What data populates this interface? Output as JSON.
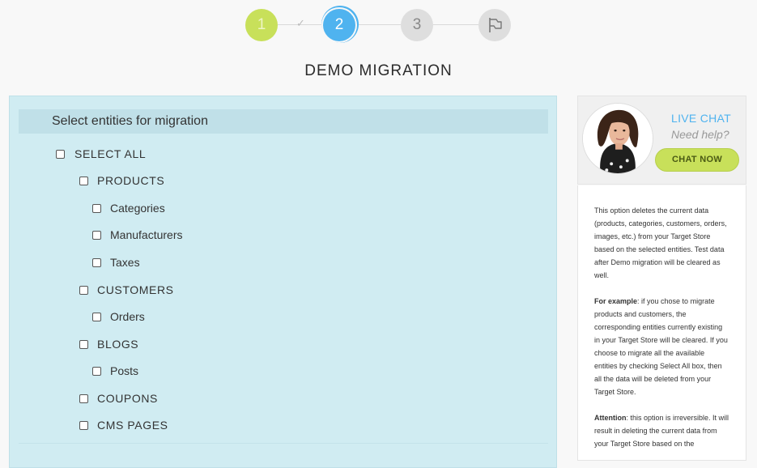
{
  "stepper": {
    "steps": [
      {
        "label": "1",
        "state": "done"
      },
      {
        "label": "2",
        "state": "active"
      },
      {
        "label": "3",
        "state": "todo"
      },
      {
        "label": "",
        "state": "todo",
        "icon": "flag-icon"
      }
    ],
    "check_mark": "✓"
  },
  "page_title": "DEMO MIGRATION",
  "entities_panel": {
    "header": "Select entities for migration",
    "items": [
      {
        "label": "SELECT ALL",
        "checked": false
      },
      {
        "label": "PRODUCTS",
        "checked": false
      },
      {
        "label": "Categories",
        "checked": false
      },
      {
        "label": "Manufacturers",
        "checked": false
      },
      {
        "label": "Taxes",
        "checked": false
      },
      {
        "label": "CUSTOMERS",
        "checked": false
      },
      {
        "label": "Orders",
        "checked": false
      },
      {
        "label": "BLOGS",
        "checked": false
      },
      {
        "label": "Posts",
        "checked": false
      },
      {
        "label": "COUPONS",
        "checked": false
      },
      {
        "label": "CMS PAGES",
        "checked": false
      }
    ]
  },
  "chat": {
    "title": "LIVE CHAT",
    "subtitle": "Need help?",
    "button_label": "CHAT NOW"
  },
  "info": {
    "para1": "This option deletes the current data (products, categories, customers, orders, images, etc.) from your Target Store based on the selected entities. Test data after Demo migration will be cleared as well.",
    "para2_bold": "For example",
    "para2": ": if you chose to migrate products and customers, the corresponding entities currently existing in your Target Store will be cleared. If you choose to migrate all the available entities by checking Select All box, then all the data will be deleted from your Target Store.",
    "para3_bold": "Attention",
    "para3": ": this option is irreversible. It will result in deleting the current data from your Target Store based on the"
  },
  "colors": {
    "done": "#c8e05a",
    "active": "#4fb3ef",
    "todo": "#dedede",
    "panel_bg": "#d0ecf2",
    "panel_header_bg": "#c0e0e8"
  }
}
